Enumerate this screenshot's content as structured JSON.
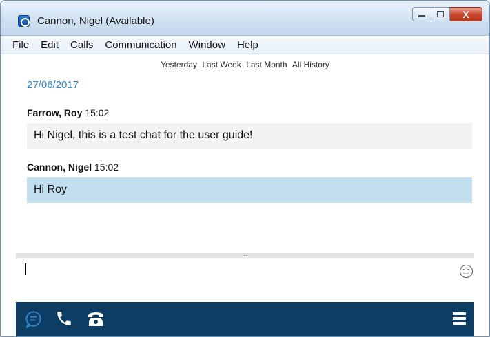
{
  "window": {
    "title": "Cannon, Nigel (Available)",
    "close_glyph": "X"
  },
  "menu": [
    "File",
    "Edit",
    "Calls",
    "Communication",
    "Window",
    "Help"
  ],
  "history_filters": [
    "Yesterday",
    "Last Week",
    "Last Month",
    "All History"
  ],
  "conversation": {
    "date": "27/06/2017",
    "messages": [
      {
        "sender": "Farrow, Roy",
        "time": "15:02",
        "text": "Hi Nigel, this is a test chat for the user guide!"
      },
      {
        "sender": "Cannon, Nigel",
        "time": "15:02",
        "text": "Hi Roy"
      }
    ]
  },
  "splitter_glyph": "...",
  "composer": {
    "value": "",
    "emoji_icon": "smiley-icon"
  },
  "toolbar": {
    "icons": [
      "chat-icon",
      "call-icon",
      "phone-icon",
      "menu-icon"
    ],
    "accent": "#2f85c6",
    "background": "#0e3d63"
  }
}
